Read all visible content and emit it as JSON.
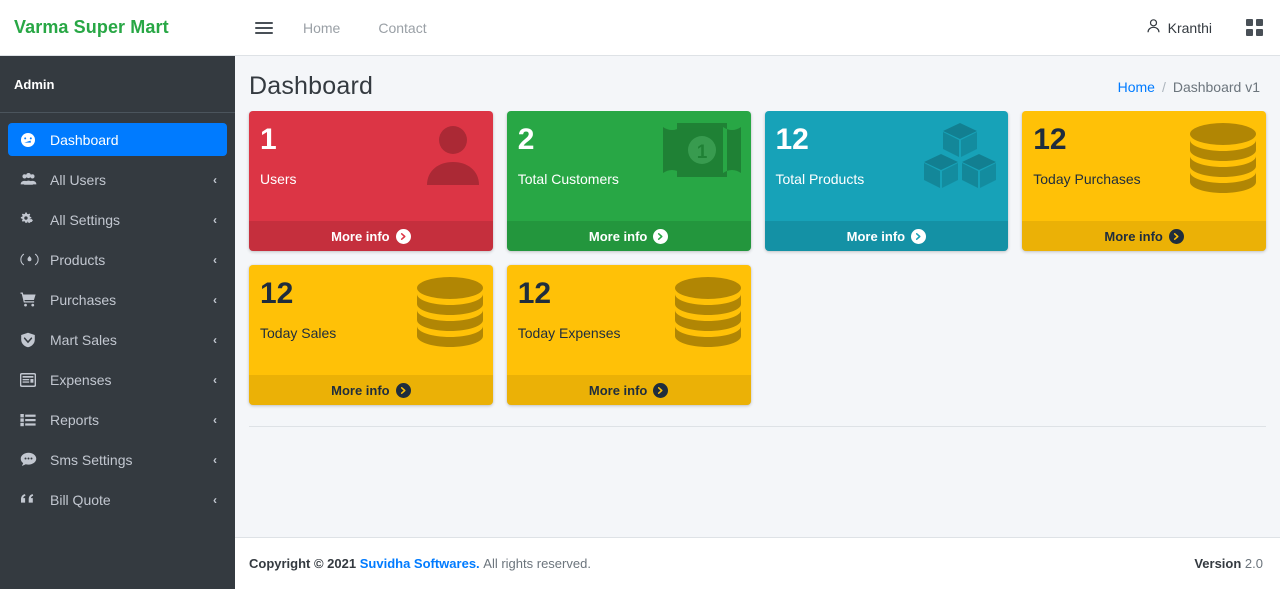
{
  "brand": {
    "name": "Varma Super Mart"
  },
  "sidebar": {
    "user_panel": {
      "name": "Admin"
    },
    "items": [
      {
        "label": "Dashboard",
        "icon": "tachometer-icon",
        "active": true,
        "arrow": ""
      },
      {
        "label": "All Users",
        "icon": "users-icon",
        "active": false,
        "arrow": "‹"
      },
      {
        "label": "All Settings",
        "icon": "gears-icon",
        "active": false,
        "arrow": "‹"
      },
      {
        "label": "Products",
        "icon": "product-tag-icon",
        "active": false,
        "arrow": "‹"
      },
      {
        "label": "Purchases",
        "icon": "cart-icon",
        "active": false,
        "arrow": "‹"
      },
      {
        "label": "Mart Sales",
        "icon": "shield-icon",
        "active": false,
        "arrow": "‹"
      },
      {
        "label": "Expenses",
        "icon": "window-icon",
        "active": false,
        "arrow": "‹"
      },
      {
        "label": "Reports",
        "icon": "list-icon",
        "active": false,
        "arrow": "‹"
      },
      {
        "label": "Sms Settings",
        "icon": "comment-icon",
        "active": false,
        "arrow": "‹"
      },
      {
        "label": "Bill Quote",
        "icon": "quote-icon",
        "active": false,
        "arrow": "‹"
      }
    ]
  },
  "topbar": {
    "menu_icon": "hamburger-icon",
    "links": [
      {
        "label": "Home"
      },
      {
        "label": "Contact"
      }
    ],
    "user": {
      "name": "Kranthi",
      "icon": "user-icon"
    },
    "apps_icon": "grid-icon"
  },
  "header": {
    "title": "Dashboard",
    "breadcrumb": {
      "home": "Home",
      "separator": "/",
      "current": "Dashboard v1"
    }
  },
  "cards": [
    {
      "number": "1",
      "label": "Users",
      "more": "More info",
      "color": "#dc3545",
      "icon": "user-silhouette-icon",
      "text": "light"
    },
    {
      "number": "2",
      "label": "Total Customers",
      "more": "More info",
      "color": "#28a745",
      "icon": "banknote-icon",
      "text": "light"
    },
    {
      "number": "12",
      "label": "Total Products",
      "more": "More info",
      "color": "#17a2b8",
      "icon": "cubes-icon",
      "text": "light"
    },
    {
      "number": "12",
      "label": "Today Purchases",
      "more": "More info",
      "color": "#ffc107",
      "icon": "database-icon",
      "text": "dark"
    },
    {
      "number": "12",
      "label": "Today Sales",
      "more": "More info",
      "color": "#ffc107",
      "icon": "database-icon",
      "text": "dark"
    },
    {
      "number": "12",
      "label": "Today Expenses",
      "more": "More info",
      "color": "#ffc107",
      "icon": "database-icon",
      "text": "dark"
    }
  ],
  "footer": {
    "copyright_prefix": "Copyright © 2021",
    "company": "Suvidha Softwares.",
    "rights": "All rights reserved.",
    "version_label": "Version",
    "version_number": "2.0"
  }
}
